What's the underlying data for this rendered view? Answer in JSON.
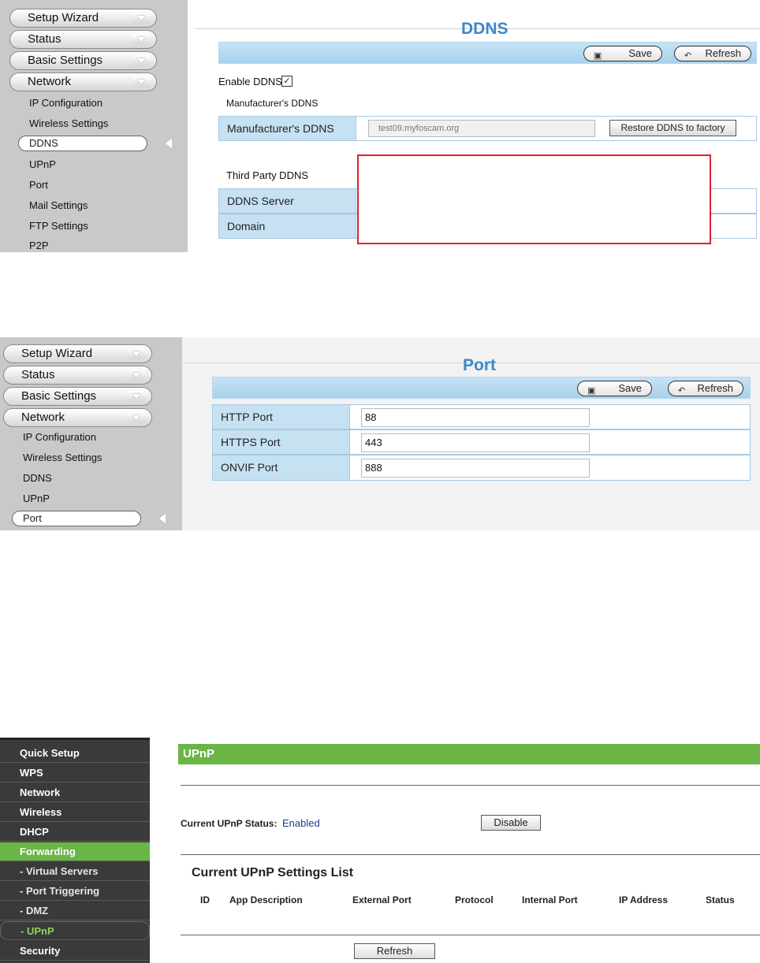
{
  "menu": {
    "setup_wizard": "Setup Wizard",
    "status": "Status",
    "basic_settings": "Basic Settings",
    "network": "Network",
    "sub": {
      "ip_configuration": "IP Configuration",
      "wireless_settings": "Wireless Settings",
      "ddns": "DDNS",
      "upnp": "UPnP",
      "port": "Port",
      "mail_settings": "Mail Settings",
      "ftp_settings": "FTP Settings",
      "p2p": "P2P"
    }
  },
  "toolbar": {
    "save_label": "Save",
    "refresh_label": "Refresh"
  },
  "ddns": {
    "title": "DDNS",
    "enable_label": "Enable DDNS",
    "enable_checked": true,
    "manufacturer_section": "Manufacturer's DDNS",
    "manufacturer_label": "Manufacturer's DDNS",
    "manufacturer_value": "test09.myfoscam.org",
    "restore_label": "Restore DDNS to factory",
    "third_party_section": "Third Party DDNS",
    "ddns_server_label": "DDNS Server",
    "domain_label": "Domain",
    "highlight_color": "#e0202a"
  },
  "port": {
    "title": "Port",
    "http_label": "HTTP Port",
    "http_value": "88",
    "https_label": "HTTPS Port",
    "https_value": "443",
    "onvif_label": "ONVIF Port",
    "onvif_value": "888"
  },
  "router": {
    "menu": [
      "Quick Setup",
      "WPS",
      "Network",
      "Wireless",
      "DHCP",
      "Forwarding",
      "- Virtual Servers",
      "- Port Triggering",
      "- DMZ",
      "- UPnP",
      "Security"
    ],
    "title": "UPnP",
    "status_label": "Current UPnP Status:",
    "status_value": "Enabled",
    "disable_label": "Disable",
    "list_title": "Current UPnP Settings List",
    "columns": [
      "ID",
      "App Description",
      "External Port",
      "Protocol",
      "Internal Port",
      "IP Address",
      "Status"
    ],
    "refresh_label": "Refresh",
    "accent": "#6ab546"
  }
}
